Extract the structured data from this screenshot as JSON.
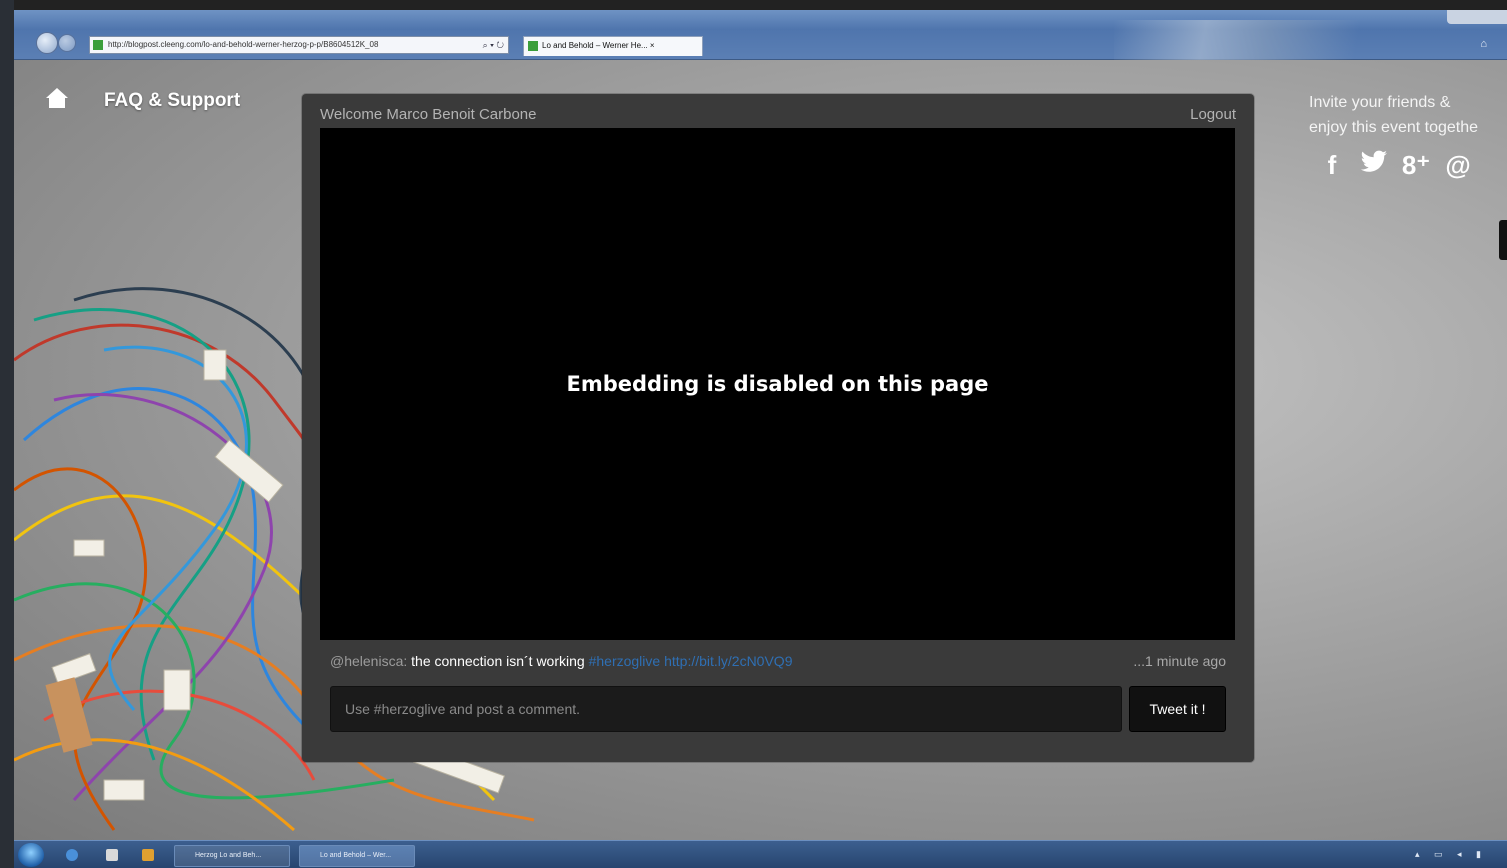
{
  "browser": {
    "address": "http://blogpost.cleeng.com/lo-and-behold-werner-herzog-p-p/B8604512K_08",
    "address_tools": "⌕ ▾ ↻",
    "tab_title": "Lo and Behold – Werner He... ×"
  },
  "nav": {
    "faq_label": "FAQ & Support"
  },
  "invite": {
    "line1": "Invite your friends &",
    "line2": "enjoy this event togethe",
    "social": [
      {
        "name": "facebook-icon",
        "glyph": "f"
      },
      {
        "name": "twitter-icon",
        "glyph": "🐦"
      },
      {
        "name": "google-plus-icon",
        "glyph": "8⁺"
      },
      {
        "name": "email-icon",
        "glyph": "@"
      }
    ]
  },
  "panel": {
    "welcome": "Welcome Marco Benoit Carbone",
    "logout": "Logout",
    "video_message": "Embedding is disabled on this page",
    "tweet": {
      "user": "@helenisca:",
      "text": " the connection isn´t working ",
      "hashtag": "#herzoglive",
      "link": " http://bit.ly/2cN0VQ9",
      "time": "...1 minute ago"
    },
    "comment_placeholder": "Use #herzoglive and post a comment.",
    "tweet_button": "Tweet it !"
  },
  "taskbar": {
    "task1": "Herzog Lo and Beh...",
    "task2": "Lo and Behold – Wer..."
  },
  "colors": {
    "accent_link": "#2f6fb3",
    "panel_bg": "#3a3a3a",
    "video_bg": "#000000"
  }
}
